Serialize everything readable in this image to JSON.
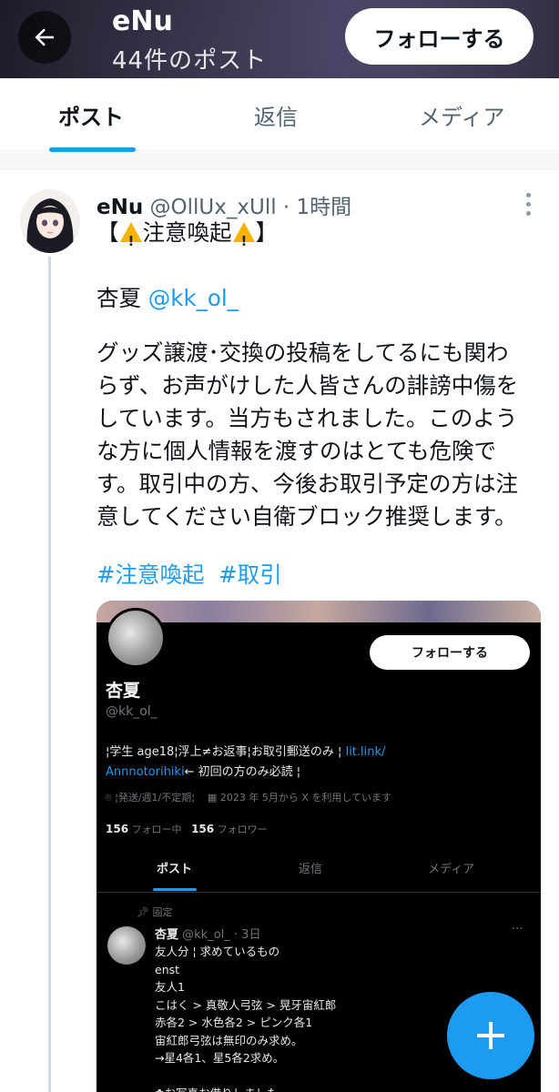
{
  "header": {
    "title": "eNu",
    "subtitle": "44件のポスト",
    "follow_label": "フォローする"
  },
  "tabs": [
    {
      "label": "ポスト",
      "active": true
    },
    {
      "label": "返信",
      "active": false
    },
    {
      "label": "メディア",
      "active": false
    }
  ],
  "post": {
    "name": "eNu",
    "handle": "@OllUx_xUll",
    "time": "1時間",
    "heading_prefix": "【",
    "heading_text": "注意喚起",
    "heading_suffix": "】",
    "mention_prefix": "杏夏 ",
    "mention": "@kk_ol_",
    "body_lines": [
      "グッズ譲渡･交換の投稿をしてるにも関わ",
      "らず、お声がけした人皆さんの誹謗中傷を",
      "しています。当方もされました。このよう",
      "な方に個人情報を渡すのはとても危険で",
      "す。取引中の方、今後お取引予定の方は注",
      "意してください自衛ブロック推奨します。"
    ],
    "hashtags": [
      "#注意喚起",
      "#取引"
    ]
  },
  "embed": {
    "follow_label": "フォローする",
    "name": "杏夏",
    "handle": "@kk_ol_",
    "bio_line1": "¦学生 age18¦浮上≠お返事¦お取引郵送のみ ¦",
    "bio_link1": "lit.link/",
    "bio_link2": "Annnotorihiki",
    "bio_line2_rest": "← 初回の方のみ必読 ¦",
    "meta_location": "¦発送/週1/不定期¦",
    "meta_joined": "2023 年 5月から X を利用しています",
    "following_count": "156",
    "following_label": "フォロー中",
    "followers_count": "156",
    "followers_label": "フォロワー",
    "tabs": [
      "ポスト",
      "返信",
      "メディア"
    ],
    "pinned_label": "固定",
    "post_name": "杏夏",
    "post_handle_time": "@kk_ol_ · 3日",
    "post_more": "···",
    "post_lines": [
      "友人分 ¦ 求めているもの",
      "enst",
      "友人1",
      "こはく > 真敬人弓弦 > 晃牙宙紅郎",
      "赤各2 > 水色各2 > ピンク各1",
      "宙紅郎弓弦は無印のみ求め。",
      "→星4各1、星5各2求め。",
      "",
      "✿お写真お借りしました。"
    ]
  },
  "colors": {
    "accent": "#1d9bf0",
    "text": "#0f1419",
    "muted": "#536471"
  },
  "icons": {
    "back": "arrow-left-icon",
    "more": "more-vertical-icon",
    "compose": "plus-icon",
    "warning": "warning-icon"
  }
}
